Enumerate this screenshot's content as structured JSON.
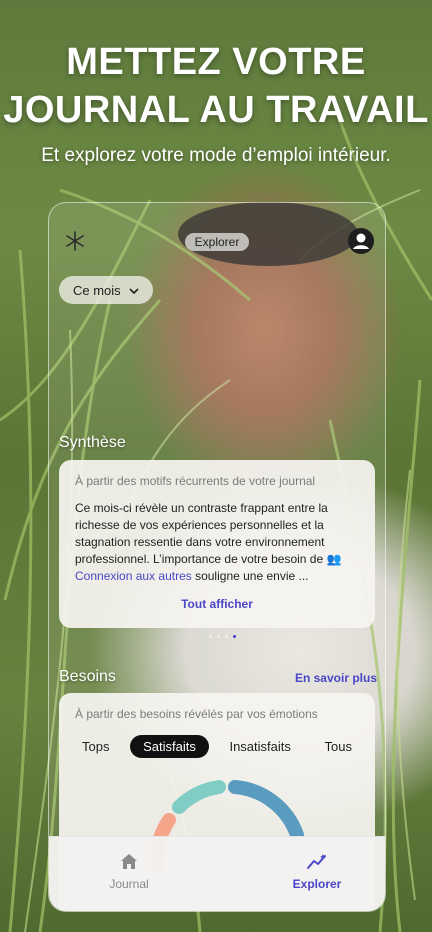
{
  "headline": {
    "line1": "METTEZ VOTRE",
    "line2": "JOURNAL AU TRAVAIL"
  },
  "subline": "Et explorez votre mode d’emploi intérieur.",
  "app": {
    "top_bar": {
      "explore_label": "Explorer",
      "left_icon": "asterisk-logo-icon",
      "right_icon": "profile-icon"
    },
    "period_filter": {
      "selected": "Ce mois",
      "icon": "chevron-down-icon"
    },
    "synthesis": {
      "title": "Synthèse",
      "subtitle": "À partir des motifs récurrents de votre journal",
      "text_before": "Ce mois-ci révèle un contraste frappant entre la richesse de vos expériences personnelles et la stagnation ressentie dans votre environnement professionnel. L’importance de votre besoin de ",
      "highlight_icon": "👥",
      "highlight": "Connexion aux autres",
      "text_after": " souligne une envie ...",
      "see_all": "Tout afficher"
    },
    "needs": {
      "title": "Besoins",
      "learn_more": "En savoir plus",
      "subtitle": "À partir des besoins révélés par vos émotions",
      "tabs": [
        {
          "label": "Tops"
        },
        {
          "label": "Satisfaits",
          "active": true
        },
        {
          "label": "Insatisfaits"
        },
        {
          "label": "Tous"
        }
      ],
      "gauge_colors": [
        "#f4a58a",
        "#7fcdc4",
        "#5a9cc0"
      ]
    },
    "bottom_nav": [
      {
        "label": "Journal",
        "icon": "home-icon"
      },
      {
        "label": "Explorer",
        "icon": "sparkline-icon",
        "active": true
      }
    ],
    "accent": "#4a46c8"
  }
}
